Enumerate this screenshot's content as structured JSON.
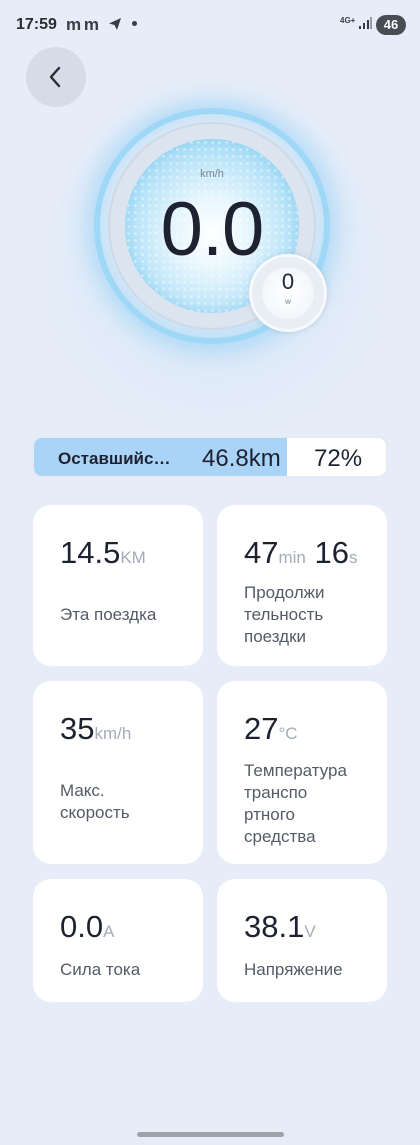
{
  "status_bar": {
    "time": "17:59",
    "apps": "m m",
    "network": "4G+",
    "battery": "46"
  },
  "speedometer": {
    "speed": "0.0",
    "speed_unit": "km/h",
    "power": "0",
    "power_unit": "w"
  },
  "range": {
    "label": "Оставшийся пробег",
    "distance": "46.8km",
    "percent": "72%",
    "fill_fraction": 0.72,
    "fill_color": "#a9d4f7"
  },
  "stats": {
    "trip": {
      "value": "14.5",
      "unit": "KM",
      "label": "Эта поездка"
    },
    "duration": {
      "minutes": "47",
      "min_unit": "min",
      "seconds": "16",
      "sec_unit": "s",
      "label_lines": [
        "Продолжи",
        "тельность",
        "поездки"
      ]
    },
    "max_speed": {
      "value": "35",
      "unit": "km/h",
      "label_lines": [
        "Макс.",
        "скорость"
      ]
    },
    "temperature": {
      "value": "27",
      "unit": "°C",
      "label_lines": [
        "Температура",
        "транспо",
        "ртного",
        "средства"
      ]
    },
    "current": {
      "value": "0.0",
      "unit": "A",
      "label": "Сила тока"
    },
    "voltage": {
      "value": "38.1",
      "unit": "V",
      "label": "Напряжение"
    }
  },
  "icons": [
    "back-arrow-icon",
    "send-icon",
    "signal-icon"
  ],
  "colors": {
    "background": "#e6edf8",
    "accent": "#9fd8f6",
    "card": "#ffffff"
  }
}
